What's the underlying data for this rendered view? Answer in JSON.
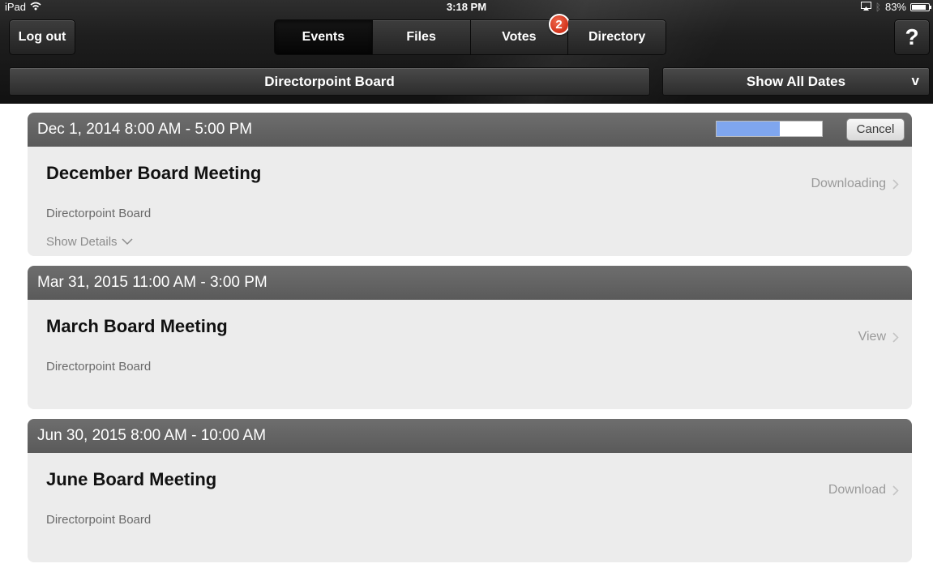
{
  "status_bar": {
    "device": "iPad",
    "time": "3:18 PM",
    "battery": "83%",
    "battery_level": 0.83
  },
  "toolbar": {
    "logout_label": "Log out",
    "help_label": "?",
    "tabs": [
      {
        "label": "Events",
        "selected": true
      },
      {
        "label": "Files",
        "selected": false
      },
      {
        "label": "Votes",
        "selected": false,
        "badge": "2"
      },
      {
        "label": "Directory",
        "selected": false
      }
    ]
  },
  "filter_bar": {
    "board_label": "Directorpoint Board",
    "dates_label": "Show All Dates",
    "dates_chevron": "v"
  },
  "events": [
    {
      "date_range": "Dec 1, 2014 8:00 AM - 5:00 PM",
      "title": "December Board Meeting",
      "organization": "Directorpoint Board",
      "details_label": "Show Details",
      "action_label": "Downloading",
      "progress": 0.6,
      "cancel_label": "Cancel"
    },
    {
      "date_range": "Mar 31, 2015 11:00 AM - 3:00 PM",
      "title": "March Board Meeting",
      "organization": "Directorpoint Board",
      "action_label": "View"
    },
    {
      "date_range": "Jun 30, 2015 8:00 AM - 10:00 AM",
      "title": "June Board Meeting",
      "organization": "Directorpoint Board",
      "action_label": "Download"
    }
  ],
  "icons": {
    "wifi": "wifi-icon",
    "airplay": "airplay-icon",
    "bluetooth": "bluetooth-icon",
    "battery": "battery-icon",
    "chevron_right": "chevron-right-icon",
    "chevron_down": "chevron-down-icon"
  },
  "colors": {
    "progress_fill": "#7fa6ef",
    "badge": "#d2321a",
    "event_header": "#636363",
    "card_bg": "#ececec"
  }
}
